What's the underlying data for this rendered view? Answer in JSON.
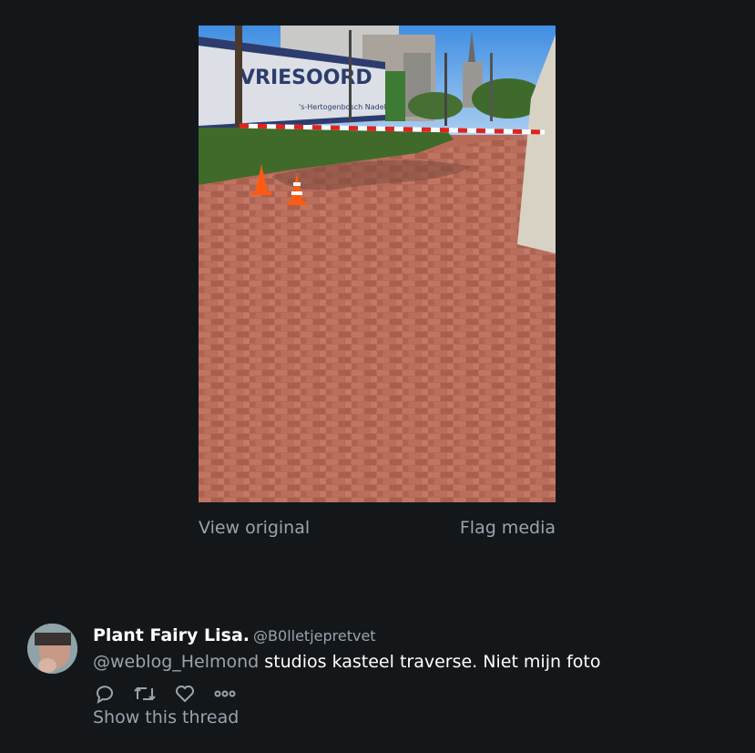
{
  "media": {
    "photo_alt": "",
    "sign_text": "VRIESOORD",
    "sign_subtext": "'s-Hertogenbosch Nadel",
    "view_original_label": "View original",
    "flag_media_label": "Flag media"
  },
  "tweet": {
    "author_name": "Plant Fairy Lisa.",
    "author_handle": "@B0lletjepretvet",
    "mention": "@weblog_Helmond",
    "body": " studios kasteel traverse. Niet mijn foto",
    "show_thread_label": "Show this thread",
    "icons": [
      "reply-icon",
      "retweet-icon",
      "like-icon",
      "more-icon"
    ]
  },
  "colors": {
    "background": "#14171a",
    "muted_text": "#9aa3ad",
    "primary_text": "#ffffff"
  }
}
